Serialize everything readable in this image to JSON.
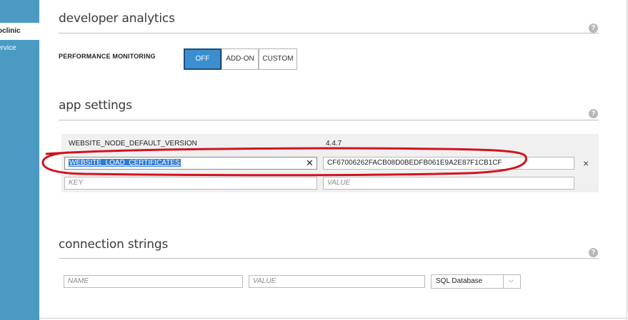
{
  "sidebar": {
    "items": [
      {
        "label": "oclinic",
        "active": true
      },
      {
        "label": "ervice",
        "active": false
      }
    ],
    "color": "#4a9ac4"
  },
  "developer_analytics": {
    "title": "developer analytics",
    "help_icon": "question-icon",
    "performance_monitoring": {
      "label": "PERFORMANCE MONITORING",
      "options": [
        "OFF",
        "ADD-ON",
        "CUSTOM"
      ],
      "selected": "OFF"
    }
  },
  "app_settings": {
    "title": "app settings",
    "help_icon": "question-icon",
    "rows": [
      {
        "key": "WEBSITE_NODE_DEFAULT_VERSION",
        "value": "4.4.7"
      },
      {
        "key": "WEBSITE_LOAD_CERTIFICATES",
        "value": "CF67006262FACB08D0BEDFB061E9A2E87F1CB1CF"
      }
    ],
    "new_key_placeholder": "KEY",
    "new_value_placeholder": "VALUE",
    "clear_glyph": "✕",
    "delete_glyph": "×",
    "annotation_color": "#d0141f"
  },
  "connection_strings": {
    "title": "connection strings",
    "help_icon": "question-icon",
    "name_placeholder": "NAME",
    "value_placeholder": "VALUE",
    "type_selected": "SQL Database"
  },
  "accent_color": "#3b8fd0"
}
